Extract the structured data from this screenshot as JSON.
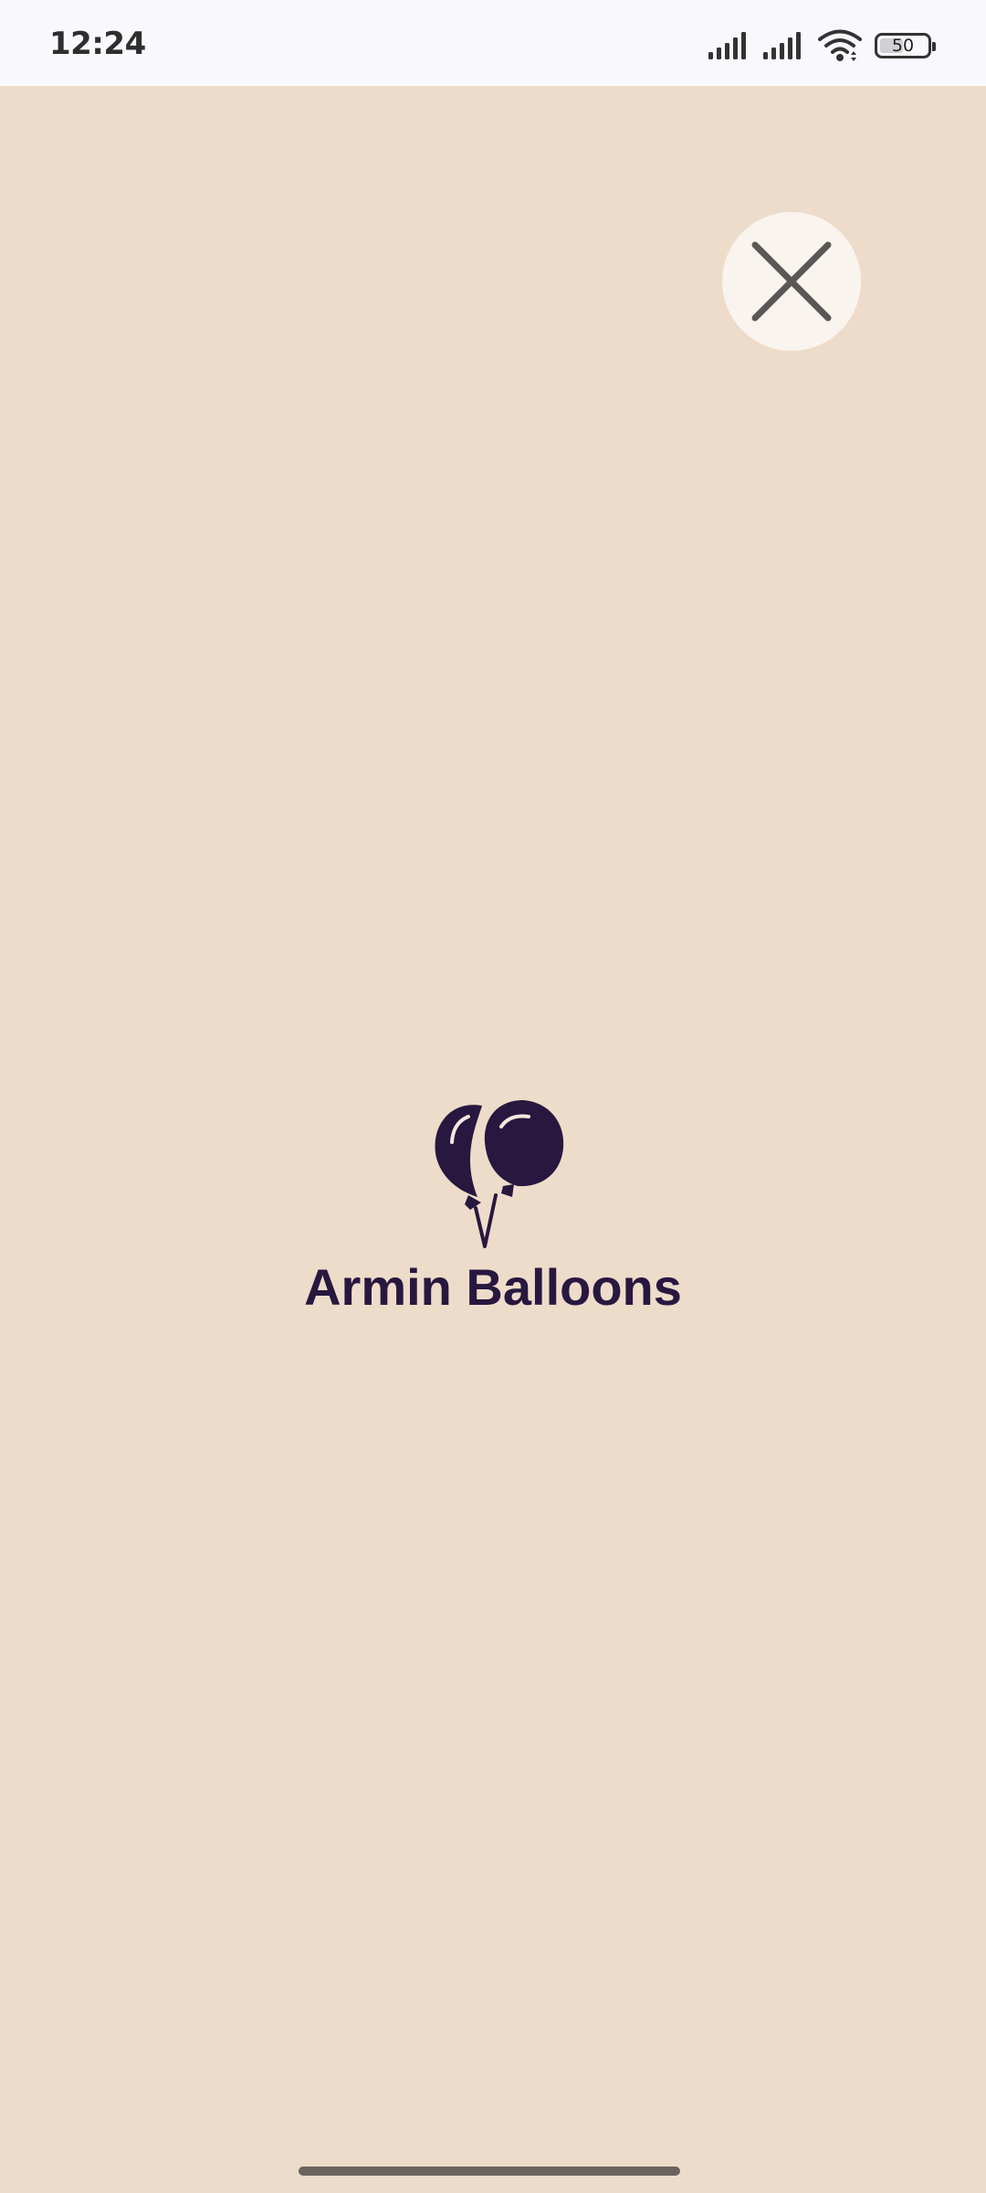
{
  "status_bar": {
    "time": "12:24",
    "battery_level": "50",
    "battery_fraction": 0.5,
    "icons": [
      "signal-icon",
      "signal-icon",
      "wifi-icon",
      "battery-icon"
    ]
  },
  "splash": {
    "brand_name": "Armin Balloons",
    "logo_icon": "balloons-icon",
    "close_icon": "close-icon"
  },
  "colors": {
    "background": "#EEDCCA",
    "status_bar_bg": "#F9F8FD",
    "brand": "#28173F",
    "accent": "#C0392B",
    "close_button_bg": "#FAF4EE",
    "close_icon": "#5A5856"
  }
}
